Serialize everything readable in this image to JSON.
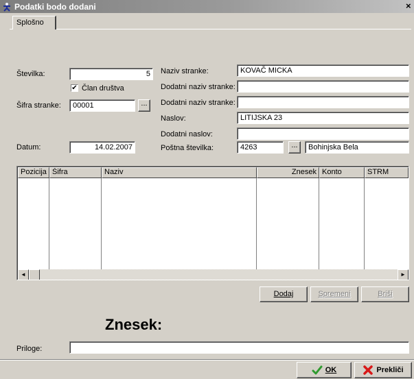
{
  "window": {
    "title": "Podatki bodo dodani",
    "close_glyph": "×",
    "app_icon": "app-figure-icon"
  },
  "tabs": [
    {
      "label": "Splošno",
      "active": true
    }
  ],
  "form": {
    "stevilka_label": "Številka:",
    "stevilka_value": "5",
    "clan_label": "Član društva",
    "clan_checked": true,
    "clan_check_glyph": "✔",
    "sifra_label": "Šifra stranke:",
    "sifra_value": "00001",
    "datum_label": "Datum:",
    "datum_value": "14.02.2007",
    "naziv_label": "Naziv stranke:",
    "naziv_value": "KOVAČ MICKA",
    "dodatni1_label": "Dodatni naziv stranke:",
    "dodatni1_value": "",
    "dodatni2_label": "Dodatni naziv stranke:",
    "dodatni2_value": "",
    "naslov_label": "Naslov:",
    "naslov_value": "LITIJSKA 23",
    "dodatni_naslov_label": "Dodatni naslov:",
    "dodatni_naslov_value": "",
    "postna_label": "Poštna številka:",
    "postna_value": "4263",
    "posta_value": "Bohinjska Bela",
    "ellipsis": "..."
  },
  "grid": {
    "columns": [
      "Pozicija",
      "Šifra",
      "Naziv",
      "Znesek",
      "Konto",
      "STRM"
    ],
    "rows": [],
    "scroll_left": "◄",
    "scroll_right": "►"
  },
  "actions": {
    "add_label": "Dodaj",
    "save_label": "Spremeni",
    "delete_label": "Briši"
  },
  "total_label": "Znesek:",
  "priloge_label": "Priloge:",
  "priloge_value": "",
  "footer": {
    "ok_label": "OK",
    "cancel_label": "Prekliči",
    "ok_icon": "check-icon",
    "cancel_icon": "red-x-icon"
  },
  "colors": {
    "ok_green": "#2e9a2e",
    "cancel_red": "#d81818",
    "face": "#d4d0c8"
  }
}
